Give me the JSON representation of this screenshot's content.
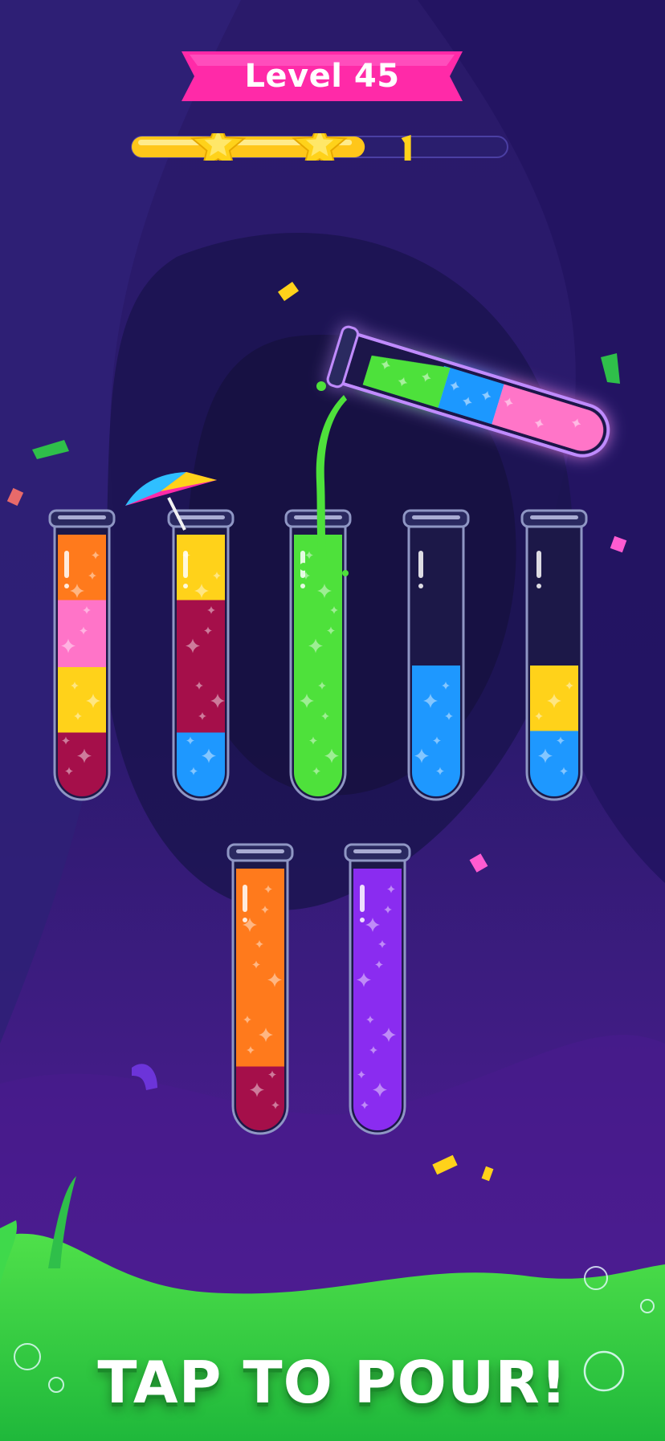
{
  "level": {
    "label": "Level 45"
  },
  "progress": {
    "stars_earned": 2,
    "fill_fraction": 0.62
  },
  "colors": {
    "orange": "#ff7a1c",
    "pink": "#ff74c8",
    "yellow": "#ffd21a",
    "crimson": "#a50f4a",
    "blue": "#1e98ff",
    "green": "#4ee13b",
    "purple": "#8a2cf0",
    "tube_rim": "#8f96c4",
    "banner": "#ff2aa8",
    "cta_green": "#2ecf45"
  },
  "tubes": [
    {
      "name": "tube-1",
      "layers": [
        "crimson",
        "yellow",
        "pink",
        "orange"
      ]
    },
    {
      "name": "tube-2",
      "layers": [
        "blue",
        "crimson",
        "crimson",
        "yellow"
      ]
    },
    {
      "name": "tube-3",
      "layers": [
        "green",
        "green",
        "green",
        "green"
      ]
    },
    {
      "name": "tube-4",
      "layers": [
        "blue",
        "blue"
      ]
    },
    {
      "name": "tube-5",
      "layers": [
        "blue",
        "yellow"
      ]
    },
    {
      "name": "tube-6",
      "layers": [
        "crimson",
        "orange",
        "orange",
        "orange"
      ]
    },
    {
      "name": "tube-7",
      "layers": [
        "purple",
        "purple",
        "purple",
        "purple"
      ]
    }
  ],
  "pouring_tube": {
    "layers": [
      "pink",
      "blue",
      "green"
    ],
    "pour_color": "green"
  },
  "cta": {
    "label": "TAP TO POUR!"
  }
}
